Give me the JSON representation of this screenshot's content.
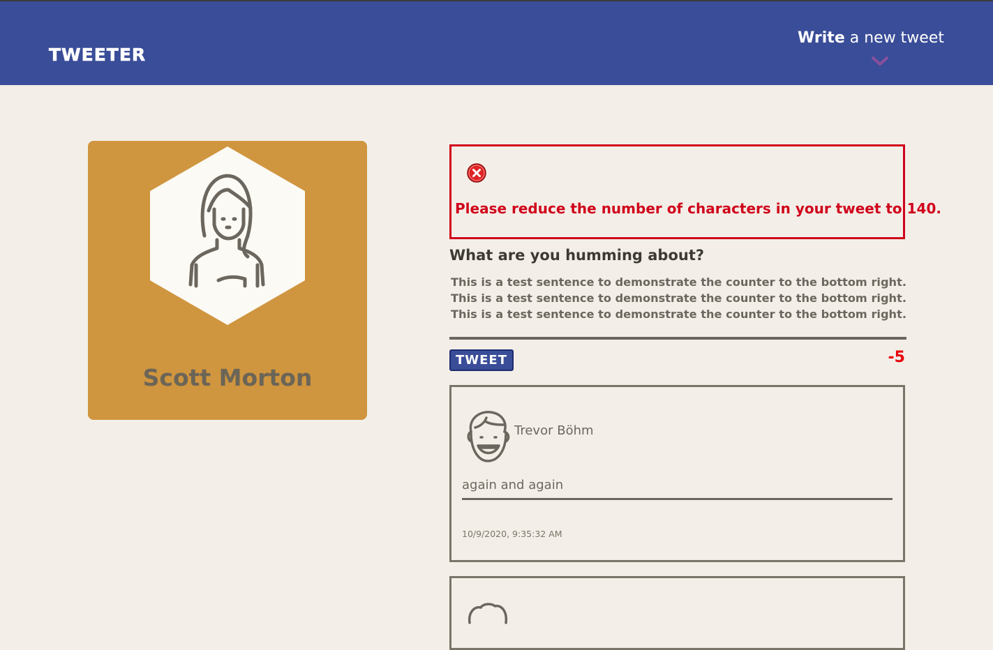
{
  "nav": {
    "brand": "TWEETER",
    "compose_bold": "Write",
    "compose_rest": " a new tweet"
  },
  "profile": {
    "name": "Scott Morton",
    "accent": "#cf953f"
  },
  "error": {
    "message": "Please reduce the number of characters in your tweet to 140.",
    "color": "#d0021b"
  },
  "compose": {
    "label": "What are you humming about?",
    "text": "This is a test sentence to demonstrate the counter to the bottom right. This is a test sentence to demonstrate the counter to the bottom right. This is a test sentence to demonstrate the counter to the bottom right.",
    "button_label": "TWEET",
    "counter": "-5"
  },
  "tweets": [
    {
      "author": "Trevor Böhm",
      "content": "again and again",
      "timestamp": "10/9/2020, 9:35:32 AM"
    }
  ],
  "colors": {
    "nav": "#3a4d98",
    "background": "#f3efe8",
    "text": "#6c675e"
  }
}
